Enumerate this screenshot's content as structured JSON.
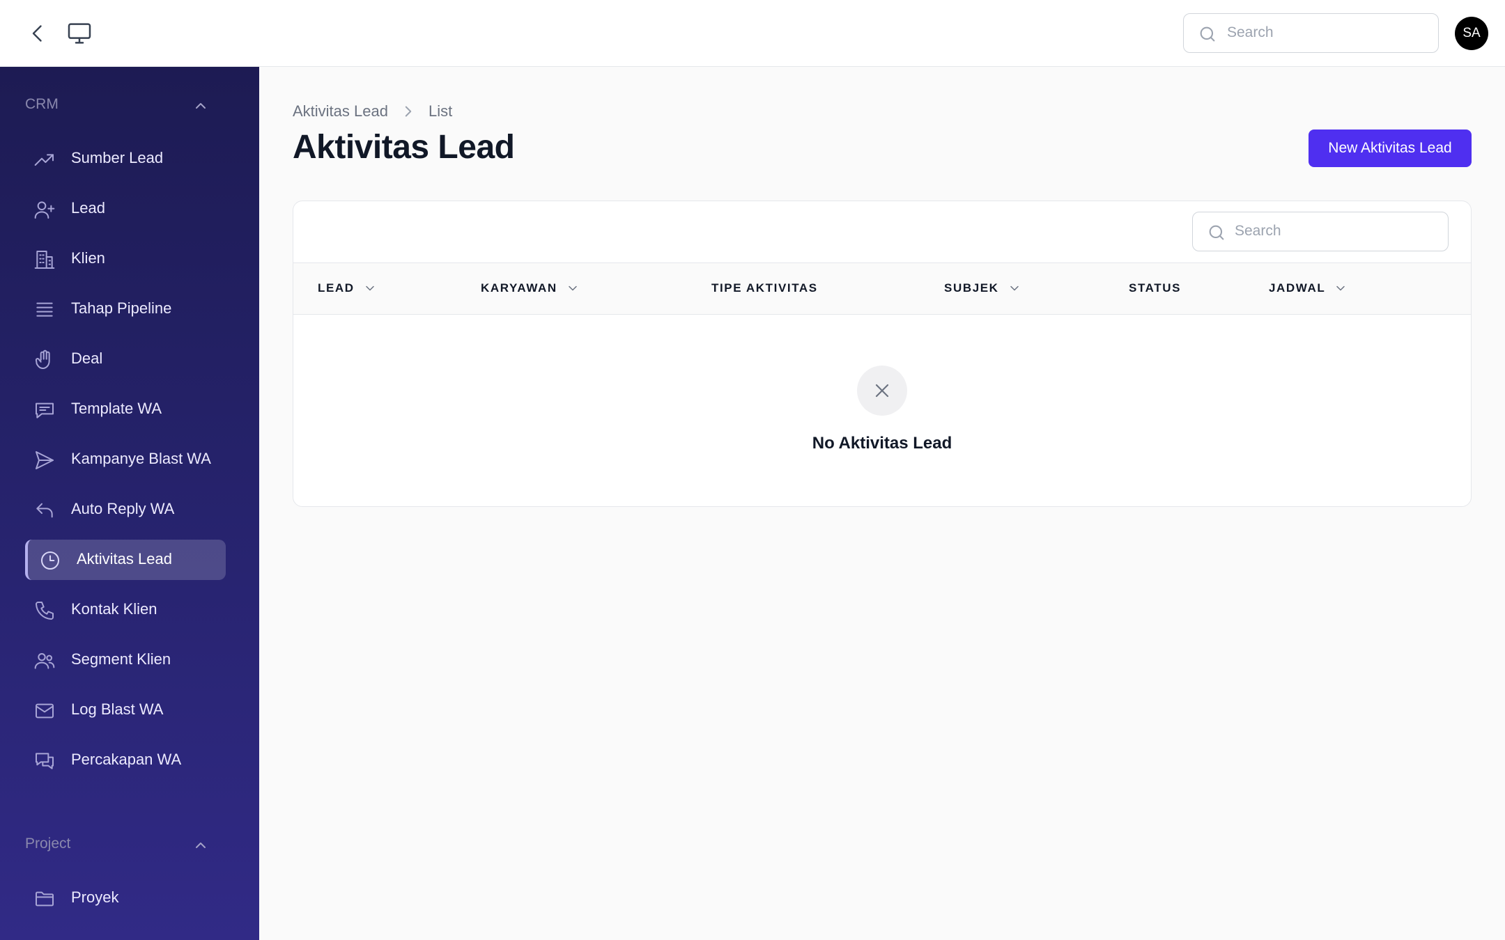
{
  "topbar": {
    "search_placeholder": "Search",
    "avatar_initials": "SA"
  },
  "sidebar": {
    "groups": [
      {
        "label": "CRM",
        "items": [
          {
            "label": "Sumber Lead",
            "icon": "trending-up-icon"
          },
          {
            "label": "Lead",
            "icon": "user-plus-icon"
          },
          {
            "label": "Klien",
            "icon": "building-icon"
          },
          {
            "label": "Tahap Pipeline",
            "icon": "lines-icon"
          },
          {
            "label": "Deal",
            "icon": "hand-icon"
          },
          {
            "label": "Template WA",
            "icon": "chat-bubble-icon"
          },
          {
            "label": "Kampanye Blast WA",
            "icon": "paper-plane-icon"
          },
          {
            "label": "Auto Reply WA",
            "icon": "reply-icon"
          },
          {
            "label": "Aktivitas Lead",
            "icon": "clock-icon",
            "active": true
          },
          {
            "label": "Kontak Klien",
            "icon": "phone-icon"
          },
          {
            "label": "Segment Klien",
            "icon": "users-icon"
          },
          {
            "label": "Log Blast WA",
            "icon": "envelope-icon"
          },
          {
            "label": "Percakapan WA",
            "icon": "chat-bubbles-icon"
          }
        ]
      },
      {
        "label": "Project",
        "items": [
          {
            "label": "Proyek",
            "icon": "folder-icon"
          }
        ]
      }
    ]
  },
  "main": {
    "breadcrumb": [
      "Aktivitas Lead",
      "List"
    ],
    "title": "Aktivitas Lead",
    "new_button_label": "New Aktivitas Lead",
    "table": {
      "search_placeholder": "Search",
      "columns": [
        {
          "label": "LEAD",
          "sortable": true
        },
        {
          "label": "KARYAWAN",
          "sortable": true
        },
        {
          "label": "TIPE AKTIVITAS",
          "sortable": false
        },
        {
          "label": "SUBJEK",
          "sortable": true
        },
        {
          "label": "STATUS",
          "sortable": false
        },
        {
          "label": "JADWAL",
          "sortable": true
        }
      ],
      "empty_text": "No Aktivitas Lead"
    }
  },
  "colors": {
    "primary": "#4f2ff0",
    "sidebar_top": "#1d1b53",
    "sidebar_bottom": "#312a86"
  }
}
